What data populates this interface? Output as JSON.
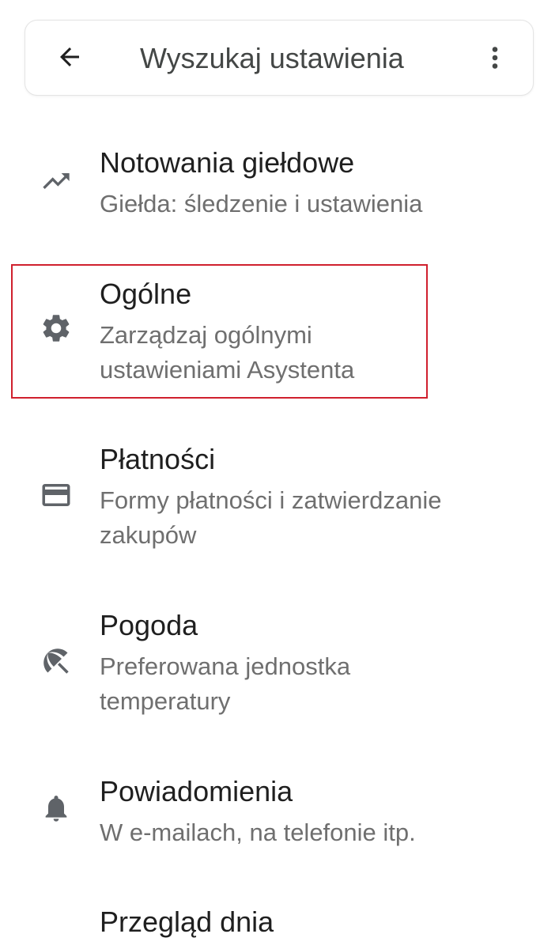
{
  "search": {
    "placeholder": "Wyszukaj ustawienia",
    "back_icon": "arrow-back-icon",
    "more_icon": "more-vert-icon"
  },
  "items": [
    {
      "title": "Notowania giełdowe",
      "subtitle": "Giełda: śledzenie i ustawienia",
      "icon": "trending-up-icon"
    },
    {
      "title": "Ogólne",
      "subtitle": "Zarządzaj ogólnymi ustawieniami Asystenta",
      "icon": "gear-icon",
      "highlighted": true
    },
    {
      "title": "Płatności",
      "subtitle": "Formy płatności i zatwierdzanie zakupów",
      "icon": "credit-card-icon"
    },
    {
      "title": "Pogoda",
      "subtitle": "Preferowana jednostka temperatury",
      "icon": "beach-umbrella-icon"
    },
    {
      "title": "Powiadomienia",
      "subtitle": "W e-mailach, na telefonie itp.",
      "icon": "bell-icon"
    },
    {
      "title": "Przegląd dnia",
      "subtitle": "",
      "icon": ""
    }
  ],
  "colors": {
    "highlight": "#d0202e",
    "title": "#1f1f1f",
    "subtitle": "#6f6f6f",
    "icon": "#5f6368"
  }
}
